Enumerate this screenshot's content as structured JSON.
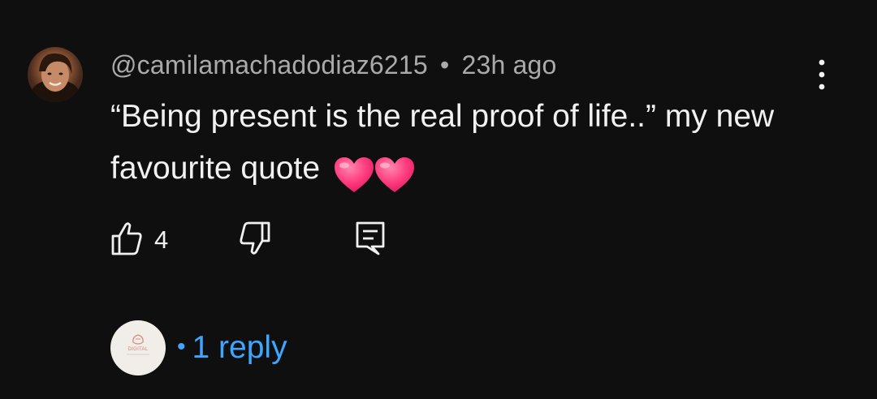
{
  "comment": {
    "author": "@camilamachadodiaz6215",
    "separator": "•",
    "time": "23h ago",
    "text": "“Being present is the real proof of life..” my new favourite quote",
    "emojis": [
      "heart-emoji",
      "heart-emoji"
    ]
  },
  "actions": {
    "like_count": "4",
    "icons": [
      "thumbs-up-icon",
      "thumbs-down-icon",
      "reply-icon"
    ]
  },
  "replies": {
    "bullet": "•",
    "label": "1 reply",
    "creator_logo_text": "DIGITAL"
  },
  "colors": {
    "background": "#0f0f0f",
    "primary_text": "#f1f1f1",
    "secondary_text": "#aaaaaa",
    "link_blue": "#3ea6ff",
    "heart_pink": "#ff3d7f"
  }
}
